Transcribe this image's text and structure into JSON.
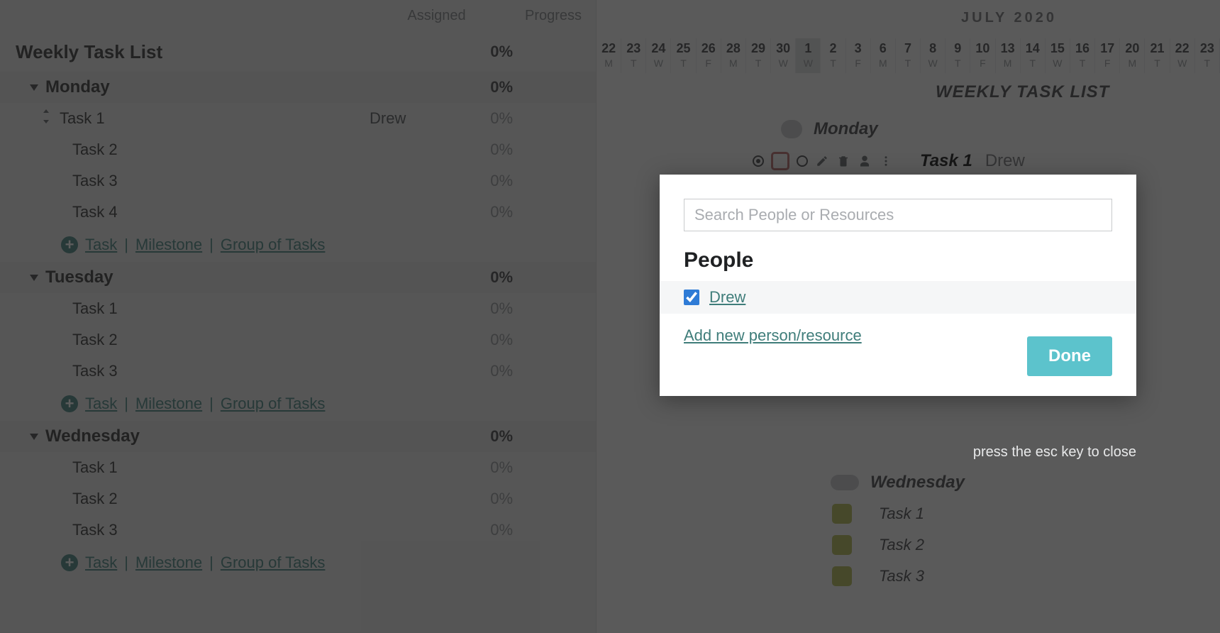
{
  "table": {
    "headers": {
      "assigned": "Assigned",
      "progress": "Progress"
    },
    "title": "Weekly Task List",
    "title_progress": "0%",
    "groups": [
      {
        "name": "Monday",
        "progress": "0%",
        "tasks": [
          {
            "name": "Task 1",
            "assigned": "Drew",
            "progress": "0%"
          },
          {
            "name": "Task 2",
            "assigned": "",
            "progress": "0%"
          },
          {
            "name": "Task 3",
            "assigned": "",
            "progress": "0%"
          },
          {
            "name": "Task 4",
            "assigned": "",
            "progress": "0%"
          }
        ]
      },
      {
        "name": "Tuesday",
        "progress": "0%",
        "tasks": [
          {
            "name": "Task 1",
            "assigned": "",
            "progress": "0%"
          },
          {
            "name": "Task 2",
            "assigned": "",
            "progress": "0%"
          },
          {
            "name": "Task 3",
            "assigned": "",
            "progress": "0%"
          }
        ]
      },
      {
        "name": "Wednesday",
        "progress": "0%",
        "tasks": [
          {
            "name": "Task 1",
            "assigned": "",
            "progress": "0%"
          },
          {
            "name": "Task 2",
            "assigned": "",
            "progress": "0%"
          },
          {
            "name": "Task 3",
            "assigned": "",
            "progress": "0%"
          }
        ]
      }
    ],
    "add": {
      "task": "Task",
      "milestone": "Milestone",
      "group": "Group of Tasks",
      "sep": "|"
    }
  },
  "timeline": {
    "month": "JULY 2020",
    "title": "WEEKLY TASK LIST",
    "days": [
      {
        "d": "22",
        "w": "M"
      },
      {
        "d": "23",
        "w": "T"
      },
      {
        "d": "24",
        "w": "W"
      },
      {
        "d": "25",
        "w": "T"
      },
      {
        "d": "26",
        "w": "F"
      },
      {
        "d": "28",
        "w": "M"
      },
      {
        "d": "29",
        "w": "T"
      },
      {
        "d": "30",
        "w": "W"
      },
      {
        "d": "1",
        "w": "W"
      },
      {
        "d": "2",
        "w": "T"
      },
      {
        "d": "3",
        "w": "F"
      },
      {
        "d": "6",
        "w": "M"
      },
      {
        "d": "7",
        "w": "T"
      },
      {
        "d": "8",
        "w": "W"
      },
      {
        "d": "9",
        "w": "T"
      },
      {
        "d": "10",
        "w": "F"
      },
      {
        "d": "13",
        "w": "M"
      },
      {
        "d": "14",
        "w": "T"
      },
      {
        "d": "15",
        "w": "W"
      },
      {
        "d": "16",
        "w": "T"
      },
      {
        "d": "17",
        "w": "F"
      },
      {
        "d": "20",
        "w": "M"
      },
      {
        "d": "21",
        "w": "T"
      },
      {
        "d": "22",
        "w": "W"
      },
      {
        "d": "23",
        "w": "T"
      }
    ],
    "today_index": 8,
    "monday_label": "Monday",
    "task1": {
      "label": "Task 1",
      "assigned": "Drew"
    },
    "wednesday_label": "Wednesday",
    "wed_tasks": [
      "Task 1",
      "Task 2",
      "Task 3"
    ]
  },
  "modal": {
    "search_placeholder": "Search People or Resources",
    "heading": "People",
    "people": [
      {
        "name": "Drew",
        "checked": true
      }
    ],
    "add_link": "Add new person/resource",
    "done": "Done",
    "esc_hint": "press the esc key to close"
  }
}
